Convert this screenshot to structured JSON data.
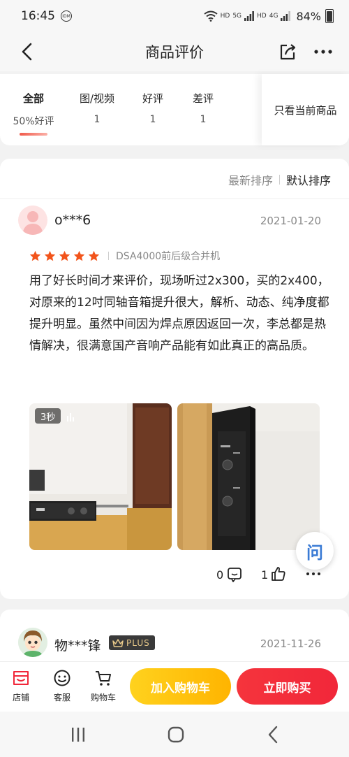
{
  "status_bar": {
    "time": "16:45",
    "idm": "IDM",
    "hd1": "HD",
    "net1": "5G",
    "hd2": "HD",
    "net2": "4G",
    "battery": "84%"
  },
  "nav": {
    "title": "商品评价"
  },
  "filters": {
    "tabs": [
      {
        "label": "全部",
        "sub": "50%好评"
      },
      {
        "label": "图/视频",
        "sub": "1"
      },
      {
        "label": "好评",
        "sub": "1"
      },
      {
        "label": "差评",
        "sub": "1"
      }
    ],
    "only_current": "只看当前商品"
  },
  "sort": {
    "newest": "最新排序",
    "default": "默认排序"
  },
  "review1": {
    "username": "o***6",
    "date": "2021-01-20",
    "stars": 5,
    "variant": "DSA4000前后级合并机",
    "text": "用了好长时间才来评价，现场听过2x300，买的2x400，对原来的12吋同轴音箱提升很大，解析、动态、纯净度都提升明显。虽然中间因为焊点原因返回一次，李总都是热情解决，很满意国产音响产品能有如此真正的高品质。",
    "video_length": "3秒",
    "comments": "0",
    "likes": "1"
  },
  "ask_fab": "问",
  "review2": {
    "username": "物***锋",
    "badge": "PLUS",
    "date": "2021-11-26"
  },
  "bottom_bar": {
    "store": "店铺",
    "service": "客服",
    "cart": "购物车",
    "add_to_cart": "加入购物车",
    "buy_now": "立即购买"
  },
  "colors": {
    "accent_red": "#f1273a",
    "accent_yellow": "#ffb400",
    "star": "#f2541b"
  }
}
